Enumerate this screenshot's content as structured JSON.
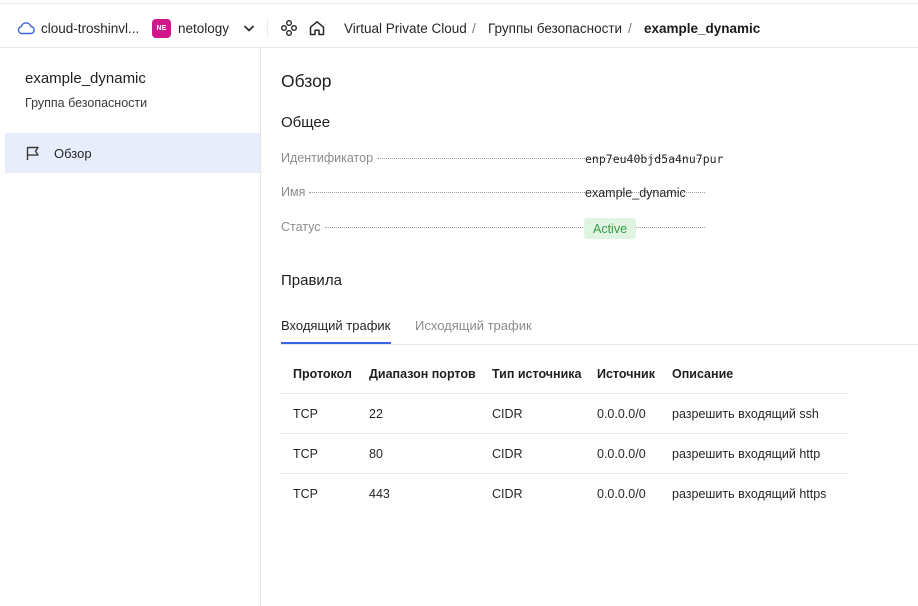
{
  "header": {
    "cloud_name": "cloud-troshinvl...",
    "org_badge": "NE",
    "org_name": "netology",
    "breadcrumbs": [
      "Virtual Private Cloud",
      "Группы безопасности",
      "example_dynamic"
    ],
    "separator": "/"
  },
  "sidebar": {
    "resource_title": "example_dynamic",
    "resource_subtitle": "Группа безопасности",
    "items": [
      {
        "label": "Обзор",
        "icon": "flag-icon",
        "active": true
      }
    ]
  },
  "main": {
    "title": "Обзор",
    "general_heading": "Общее",
    "fields": [
      {
        "label": "Идентификатор",
        "value": "enp7eu40bjd5a4nu7pur"
      },
      {
        "label": "Имя",
        "value": "example_dynamic"
      },
      {
        "label": "Статус",
        "value": "Active"
      }
    ],
    "rules_heading": "Правила",
    "tabs": [
      {
        "label": "Входящий трафик",
        "active": true
      },
      {
        "label": "Исходящий трафик",
        "active": false
      }
    ],
    "table": {
      "columns": [
        "Протокол",
        "Диапазон портов",
        "Тип источника",
        "Источник",
        "Описание"
      ],
      "rows": [
        [
          "TCP",
          "22",
          "CIDR",
          "0.0.0.0/0",
          "разрешить входящий ssh"
        ],
        [
          "TCP",
          "80",
          "CIDR",
          "0.0.0.0/0",
          "разрешить входящий http"
        ],
        [
          "TCP",
          "443",
          "CIDR",
          "0.0.0.0/0",
          "разрешить входящий https"
        ]
      ]
    }
  },
  "colors": {
    "accent": "#3a63e3",
    "nav_active_bg": "#e8edfb",
    "status_bg": "#dff5e1",
    "status_text": "#2f9e45",
    "org_badge": "#d0168b"
  }
}
